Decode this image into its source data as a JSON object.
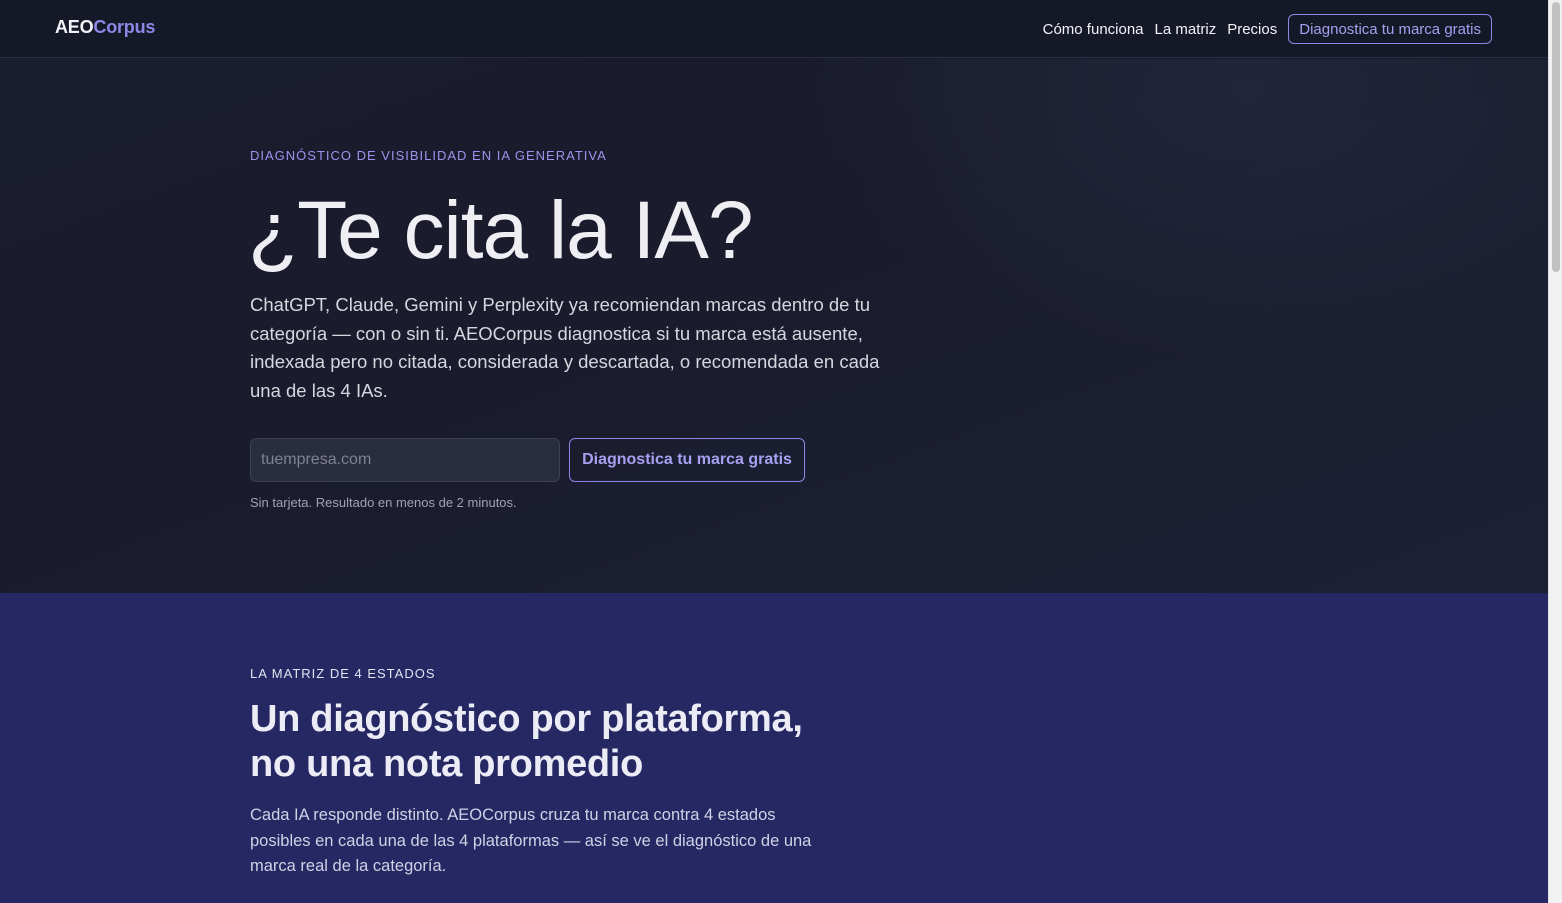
{
  "header": {
    "logo_part1": "AEO",
    "logo_part2": "Corpus",
    "nav": [
      {
        "label": "Cómo funciona"
      },
      {
        "label": "La matriz"
      },
      {
        "label": "Precios"
      }
    ],
    "cta_label": "Diagnostica tu marca gratis"
  },
  "hero": {
    "eyebrow": "DIAGNÓSTICO DE VISIBILIDAD EN IA GENERATIVA",
    "title": "¿Te cita la IA?",
    "lead": "ChatGPT, Claude, Gemini y Perplexity ya recomiendan marcas dentro de tu categoría — con o sin ti. AEOCorpus diagnostica si tu marca está ausente, indexada pero no citada, considerada y descartada, o recomendada en cada una de las 4 IAs.",
    "input_placeholder": "tuempresa.com",
    "input_value": "",
    "cta_label": "Diagnostica tu marca gratis",
    "note": "Sin tarjeta. Resultado en menos de 2 minutos."
  },
  "matrix": {
    "eyebrow": "LA MATRIZ DE 4 ESTADOS",
    "title": "Un diagnóstico por plataforma, no una nota promedio",
    "lead": "Cada IA responde distinto. AEOCorpus cruza tu marca contra 4 estados posibles en cada una de las 4 plataformas — así se ve el diagnóstico de una marca real de la categoría."
  },
  "colors": {
    "accent": "#8f86e6",
    "hero_bg": "#1a1d2f",
    "matrix_bg": "#252862"
  }
}
